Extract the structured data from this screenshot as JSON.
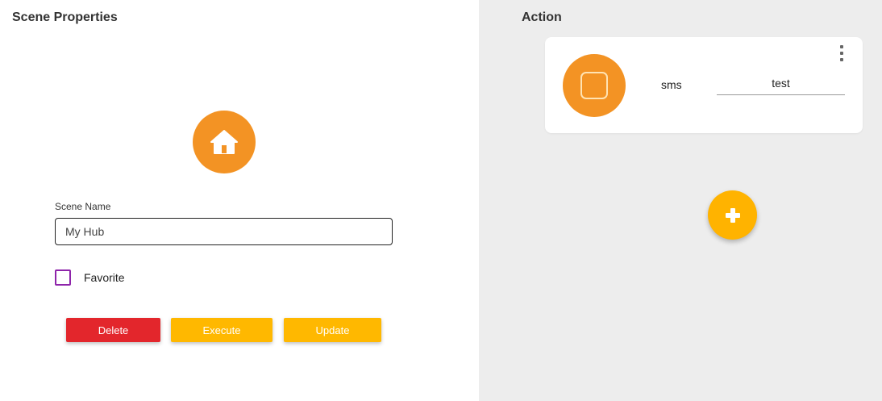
{
  "scene_properties": {
    "title": "Scene Properties",
    "icon": "home-icon",
    "icon_bg_color": "#f39324",
    "scene_name_label": "Scene Name",
    "scene_name_value": "My Hub",
    "favorite_label": "Favorite",
    "favorite_checked": false,
    "buttons": {
      "delete_label": "Delete",
      "execute_label": "Execute",
      "update_label": "Update"
    },
    "colors": {
      "delete": "#e3262c",
      "execute": "#ffb800",
      "update": "#ffb800",
      "checkbox_border": "#8e24aa"
    }
  },
  "action_panel": {
    "title": "Action",
    "actions": [
      {
        "icon": "square-icon",
        "type": "sms",
        "value": "test",
        "menu_icon": "more-vert-icon"
      }
    ],
    "add_icon": "plus-icon",
    "add_button_color": "#ffb300",
    "background": "#ededed"
  }
}
